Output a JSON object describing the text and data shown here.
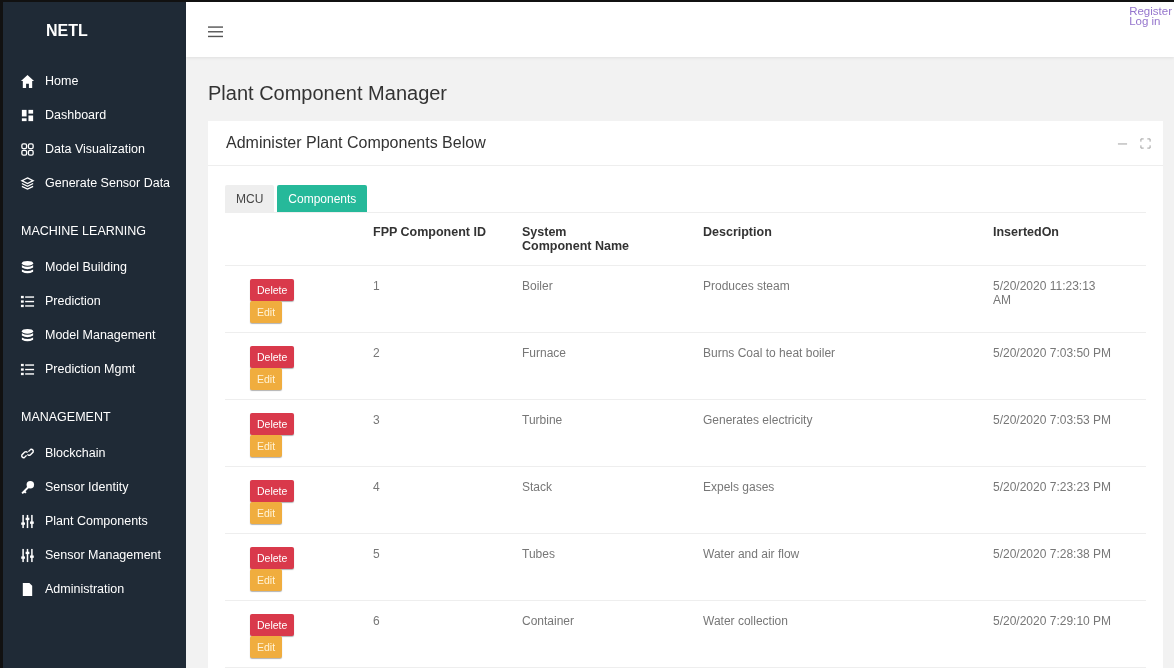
{
  "sidebar": {
    "brand": "NETL",
    "sections": [
      {
        "items": [
          {
            "label": "Home"
          },
          {
            "label": "Dashboard"
          },
          {
            "label": "Data Visualization"
          },
          {
            "label": "Generate Sensor Data"
          }
        ]
      },
      {
        "heading": "MACHINE LEARNING",
        "items": [
          {
            "label": "Model Building"
          },
          {
            "label": "Prediction"
          },
          {
            "label": "Model Management"
          },
          {
            "label": "Prediction Mgmt"
          }
        ]
      },
      {
        "heading": "MANAGEMENT",
        "items": [
          {
            "label": "Blockchain"
          },
          {
            "label": "Sensor Identity"
          },
          {
            "label": "Plant Components"
          },
          {
            "label": "Sensor Management"
          },
          {
            "label": "Administration"
          }
        ]
      }
    ]
  },
  "topbar": {
    "links": [
      "Register",
      "Log in"
    ]
  },
  "page_title": "Plant Component Manager",
  "card": {
    "title": "Administer Plant Components Below",
    "tabs": [
      {
        "label": "MCU",
        "selected": false
      },
      {
        "label": "Components",
        "selected": true
      }
    ],
    "table": {
      "columns": [
        "FPP Component ID",
        "System Component Name",
        "Description",
        "InsertedOn"
      ],
      "rows": [
        {
          "id": "1",
          "name": "Boiler",
          "description": "Produces steam",
          "inserted_on": "5/20/2020 11:23:13 AM",
          "buttons": [
            {
              "label": "Delete",
              "kind": "danger"
            },
            {
              "label": "Edit",
              "kind": "warning"
            }
          ]
        },
        {
          "id": "2",
          "name": "Furnace",
          "description": "Burns Coal to heat boiler",
          "inserted_on": "5/20/2020 7:03:50 PM",
          "buttons": [
            {
              "label": "Delete",
              "kind": "danger"
            },
            {
              "label": "Edit",
              "kind": "warning"
            }
          ]
        },
        {
          "id": "3",
          "name": "Turbine",
          "description": "Generates electricity",
          "inserted_on": "5/20/2020 7:03:53 PM",
          "buttons": [
            {
              "label": "Delete",
              "kind": "danger"
            },
            {
              "label": "Edit",
              "kind": "warning"
            }
          ]
        },
        {
          "id": "4",
          "name": "Stack",
          "description": "Expels gases",
          "inserted_on": "5/20/2020 7:23:23 PM",
          "buttons": [
            {
              "label": "Delete",
              "kind": "danger"
            },
            {
              "label": "Edit",
              "kind": "warning"
            }
          ]
        },
        {
          "id": "5",
          "name": "Tubes",
          "description": "Water and air flow",
          "inserted_on": "5/20/2020 7:28:38 PM",
          "buttons": [
            {
              "label": "Delete",
              "kind": "danger"
            },
            {
              "label": "Edit",
              "kind": "warning"
            }
          ]
        },
        {
          "id": "6",
          "name": "Container",
          "description": "Water collection",
          "inserted_on": "5/20/2020 7:29:10 PM",
          "buttons": [
            {
              "label": "Delete",
              "kind": "danger"
            },
            {
              "label": "Edit",
              "kind": "warning"
            }
          ]
        }
      ]
    }
  }
}
